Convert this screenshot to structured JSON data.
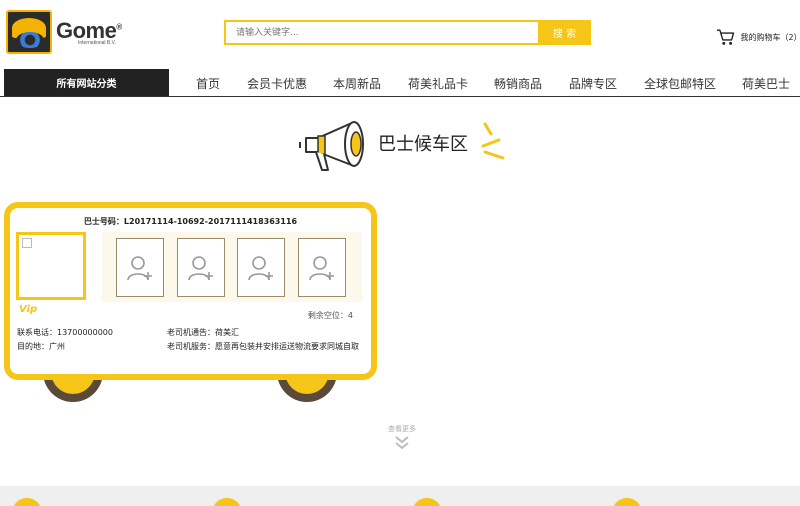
{
  "header": {
    "logo_word": "Gome",
    "logo_reg": "®",
    "logo_sub": "International B.V.",
    "search_placeholder": "请输入关键字...",
    "search_button": "搜 索",
    "cart_label": "我的购物车（2）"
  },
  "nav": {
    "all_categories": "所有网站分类",
    "items": [
      "首页",
      "会员卡优惠",
      "本周新品",
      "荷美礼品卡",
      "畅销商品",
      "品牌专区",
      "全球包邮特区",
      "荷美巴士"
    ]
  },
  "banner": {
    "title": "巴士候车区"
  },
  "bus": {
    "bus_number": "巴士号码：L20171114-10692-2017111418363116",
    "vip_label": "Vip",
    "remaining": "剩余空位：4",
    "phone": "联系电话：13700000000",
    "destination": "目的地：广州",
    "driver_notice": "老司机通告：荷美汇",
    "driver_service": "老司机服务：愿意再包装并安排运送物流要求同城自取"
  },
  "more": {
    "label": "查看更多"
  },
  "colors": {
    "accent": "#f5c518",
    "dark": "#222222",
    "wheel": "#5b4a3a"
  },
  "icons": {
    "logo": "gome-logo-icon",
    "cart": "shopping-cart-icon",
    "megaphone": "megaphone-icon",
    "seat": "add-user-icon",
    "more": "double-chevron-down-icon"
  }
}
